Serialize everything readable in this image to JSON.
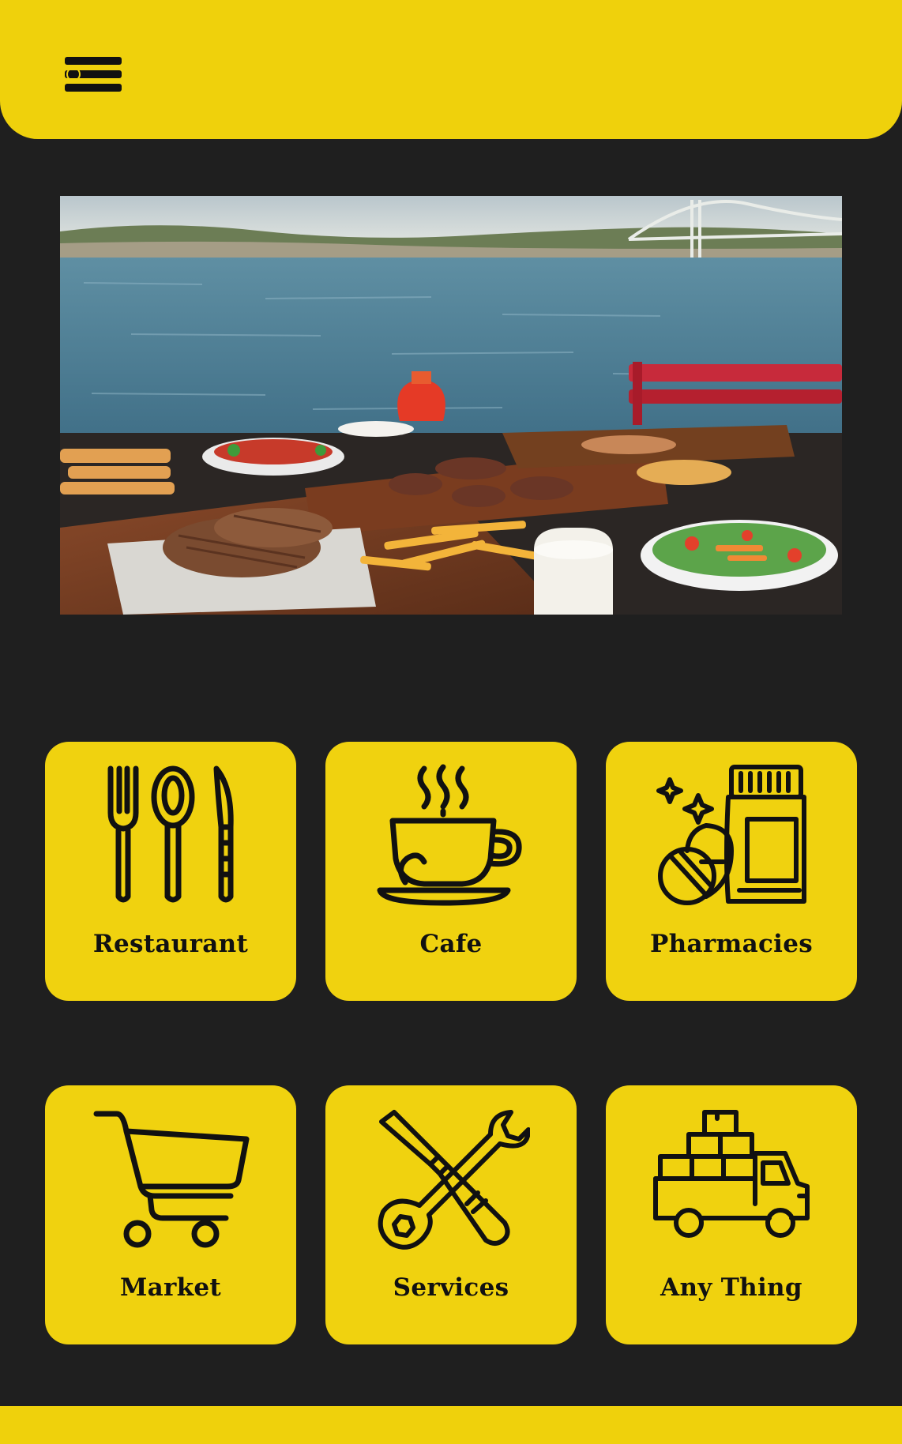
{
  "header": {
    "menu_icon": "hamburger-menu-icon",
    "background_color": "#efd10c"
  },
  "hero": {
    "alt": "Waterfront table with grilled steaks, salads and fries by the Bosphorus bridge"
  },
  "categories": [
    {
      "label": "Restaurant",
      "icon": "fork-spoon-knife-icon"
    },
    {
      "label": "Cafe",
      "icon": "coffee-cup-icon"
    },
    {
      "label": "Pharmacies",
      "icon": "medicine-bottle-icon"
    },
    {
      "label": "Market",
      "icon": "shopping-cart-icon"
    },
    {
      "label": "Services",
      "icon": "wrench-screwdriver-icon"
    },
    {
      "label": "Any Thing",
      "icon": "delivery-truck-icon"
    }
  ],
  "colors": {
    "accent": "#efd10c",
    "background": "#1f1f1f",
    "icon_stroke": "#111111"
  }
}
